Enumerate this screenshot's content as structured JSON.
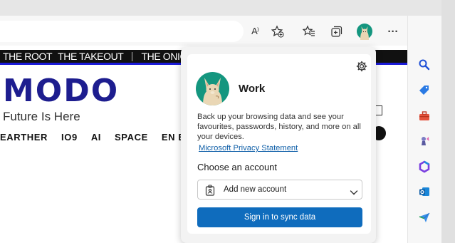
{
  "browser": {
    "toolbar": {
      "icons": [
        "read-aloud-icon",
        "add-favorite-icon",
        "favorites-icon",
        "collections-icon",
        "profile-avatar",
        "more-icon",
        "copilot-icon"
      ],
      "read_aloud_glyph": "A⁾",
      "more_glyph": "···"
    },
    "sidebar": {
      "icons": [
        "search-icon",
        "shopping-icon",
        "tools-icon",
        "games-icon",
        "microsoft-365-icon",
        "outlook-icon",
        "send-icon"
      ]
    }
  },
  "page": {
    "network_bar": [
      "THE ROOT",
      "THE TAKEOUT",
      "THE ONION"
    ],
    "logo": "MODO",
    "tagline": "Future Is Here",
    "categories": [
      "EARTHER",
      "IO9",
      "AI",
      "SPACE",
      "EN ESPAÑO"
    ]
  },
  "profile_popup": {
    "profile_name": "Work",
    "description": "Back up your browsing data and see your favourites, passwords, history, and more on all your devices.",
    "privacy_link": "Microsoft Privacy Statement",
    "choose_label": "Choose an account",
    "select_value": "Add new account",
    "sync_button": "Sign in to sync data"
  },
  "colors": {
    "accent_blue": "#0f6cbd",
    "link_blue": "#0f5fa8",
    "avatar_bg": "#14967f",
    "logo_navy": "#1d1d8f"
  }
}
